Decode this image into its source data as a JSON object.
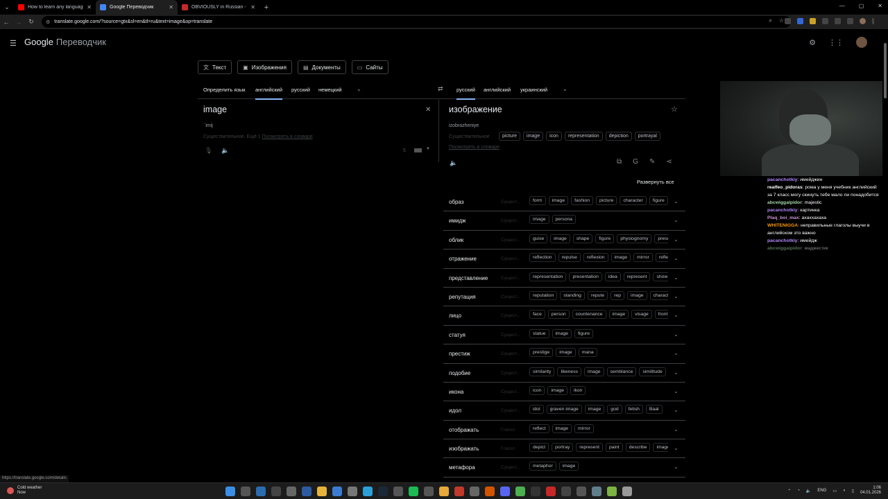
{
  "browser": {
    "tabs": [
      {
        "label": "How to learn any language in o",
        "fav_color": "#ff0000",
        "active": false
      },
      {
        "label": "Google Переводчик",
        "fav_color": "#4285f4",
        "active": true
      },
      {
        "label": "OBVIOUSLY in Russian - Cambr",
        "fav_color": "#c62828",
        "active": false
      }
    ],
    "url": "translate.google.com/?source=gtx&sl=en&tl=ru&text=image&op=translate"
  },
  "app": {
    "logo_google": "Google",
    "logo_product": "Переводчик"
  },
  "modes": [
    {
      "label": "Текст",
      "icon": "translate-icon"
    },
    {
      "label": "Изображения",
      "icon": "image-icon"
    },
    {
      "label": "Документы",
      "icon": "document-icon"
    },
    {
      "label": "Сайты",
      "icon": "web-icon"
    }
  ],
  "source_langs": [
    "Определить язык",
    "английский",
    "русский",
    "немецкий"
  ],
  "target_langs": [
    "русский",
    "английский",
    "украинский"
  ],
  "source": {
    "text": "image",
    "transcription": "ˈimij",
    "dict_hint": "Существительное. Ещё 1",
    "dict_link": "Посмотреть в словаре",
    "char_count": "5"
  },
  "target": {
    "text": "изображение",
    "translit": "izobrazheniye",
    "pos": "Существительное",
    "chips": [
      "picture",
      "image",
      "icon",
      "representation",
      "depiction",
      "portrayal"
    ],
    "dict_link": "Посмотреть в словаре"
  },
  "expand_all": "Развернуть все",
  "dictionary": [
    {
      "word": "образ",
      "pos": "Сущест...",
      "syn": [
        "form",
        "image",
        "fashion",
        "picture",
        "character",
        "figure"
      ]
    },
    {
      "word": "имидж",
      "pos": "Сущест...",
      "syn": [
        "image",
        "persona"
      ]
    },
    {
      "word": "облик",
      "pos": "Сущест...",
      "syn": [
        "guise",
        "image",
        "shape",
        "figure",
        "physiognomy",
        "presence"
      ]
    },
    {
      "word": "отражение",
      "pos": "Сущест...",
      "syn": [
        "reflection",
        "repulse",
        "reflexion",
        "image",
        "mirror",
        "reflex"
      ]
    },
    {
      "word": "представление",
      "pos": "Сущест...",
      "syn": [
        "representation",
        "presentation",
        "idea",
        "represent",
        "show"
      ]
    },
    {
      "word": "репутация",
      "pos": "Сущест...",
      "syn": [
        "reputation",
        "standing",
        "repute",
        "rep",
        "image",
        "character"
      ]
    },
    {
      "word": "лицо",
      "pos": "Сущест...",
      "syn": [
        "face",
        "person",
        "countenance",
        "image",
        "visage",
        "front"
      ]
    },
    {
      "word": "статуя",
      "pos": "Сущест...",
      "syn": [
        "statue",
        "image",
        "figure"
      ]
    },
    {
      "word": "престиж",
      "pos": "Сущест...",
      "syn": [
        "prestige",
        "image",
        "mana"
      ]
    },
    {
      "word": "подобие",
      "pos": "Сущест...",
      "syn": [
        "similarity",
        "likeness",
        "image",
        "semblance",
        "similitude"
      ]
    },
    {
      "word": "икона",
      "pos": "Сущест...",
      "syn": [
        "icon",
        "image",
        "ikon"
      ]
    },
    {
      "word": "идол",
      "pos": "Сущест...",
      "syn": [
        "idol",
        "graven image",
        "image",
        "god",
        "fetish",
        "Baal"
      ]
    },
    {
      "word": "отображать",
      "pos": "Глагол",
      "syn": [
        "reflect",
        "image",
        "mirror"
      ]
    },
    {
      "word": "изображать",
      "pos": "Глагол",
      "syn": [
        "depict",
        "portray",
        "represent",
        "paint",
        "describe",
        "image"
      ]
    },
    {
      "word": "метафора",
      "pos": "Сущест...",
      "syn": [
        "metaphor",
        "image"
      ]
    }
  ],
  "status_url": "https://translate.google.com/details",
  "chat": [
    {
      "user": "pacanchotkiy",
      "color": "#b388ff",
      "text": "имейджин"
    },
    {
      "user": "realfeo_pidoras",
      "color": "#ffffff",
      "text": "рома у меня учебник английский за 7 класс могу скинуть тебе мало ли понадобится"
    },
    {
      "user": "abcwiggalpidor",
      "color": "#a5d6a7",
      "text": "majestic"
    },
    {
      "user": "pacanchotkiy",
      "color": "#b388ff",
      "text": "картинка"
    },
    {
      "user": "Plaq_boi_max",
      "color": "#ce93d8",
      "text": "ахаххахаха"
    },
    {
      "user": "WHITENIGGA",
      "color": "#ff9800",
      "text": "неправильные глаголы выучи в английском это важно"
    },
    {
      "user": "pacanchotkiy",
      "color": "#b388ff",
      "text": "имейдж"
    },
    {
      "user": "abcwiggaipidor",
      "color": "#a5d6a7",
      "text": "маджестик",
      "faded": true
    }
  ],
  "taskbar": {
    "weather_title": "Cold weather",
    "weather_sub": "Now",
    "lang": "ENG",
    "time": "1:06",
    "date": "04.01.2026"
  }
}
